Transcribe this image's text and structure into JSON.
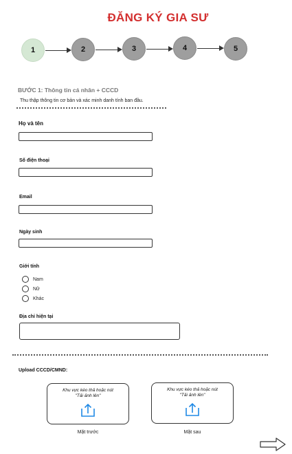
{
  "header": {
    "title": "ĐĂNG KÝ GIA SƯ"
  },
  "stepper": {
    "steps": [
      "1",
      "2",
      "3",
      "4",
      "5"
    ],
    "current_step": 1
  },
  "section": {
    "heading": "BƯỚC 1: Thông tin cá nhân + CCCD",
    "description": "Thu thập thông tin cơ bản và xác minh danh tính ban đầu."
  },
  "form": {
    "full_name_label": "Họ và tên",
    "phone_label": "Số điện thoại",
    "email_label": "Email",
    "dob_label": "Ngày sinh",
    "gender_label": "Giới tính",
    "gender_options": [
      "Nam",
      "Nữ",
      "Khác"
    ],
    "address_label": "Địa chỉ hiện tại"
  },
  "upload": {
    "label": "Upload CCCD/CMND:",
    "hint_line1": "Khu vực kéo thả hoặc nút",
    "hint_line2": "\"Tải ảnh lên\"",
    "front_caption": "Mặt trước",
    "back_caption": "Mặt sau"
  },
  "colors": {
    "title": "#d32f2f",
    "step_done": "#d5e8d4",
    "step_todo": "#9e9e9e",
    "upload_icon": "#1e88e5"
  },
  "icons": {
    "upload": "upload-icon",
    "next": "next-arrow-icon"
  }
}
